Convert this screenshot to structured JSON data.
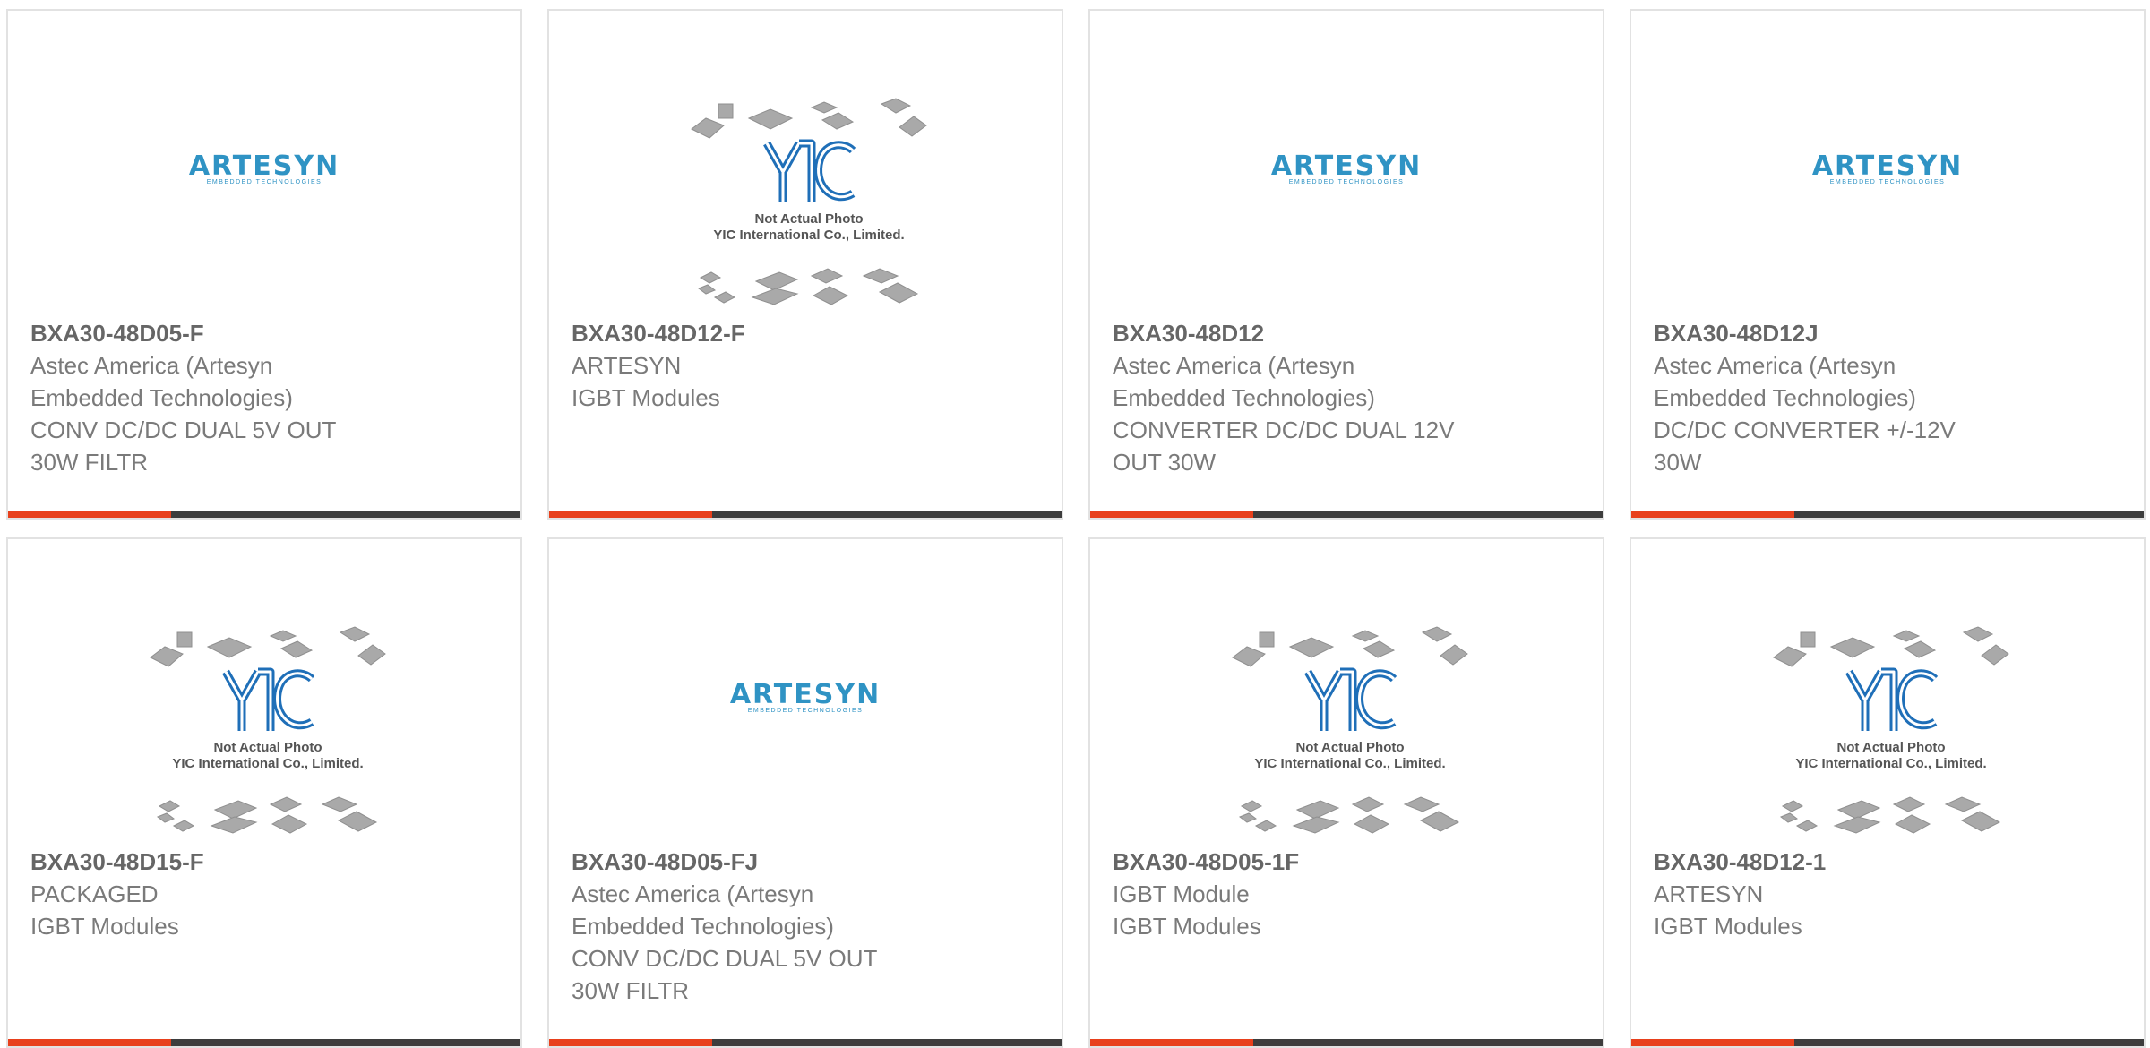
{
  "products": [
    {
      "part_number": "BXA30-48D05-F",
      "manufacturer": "Astec America (Artesyn",
      "manufacturer_cont": "Embedded Technologies)",
      "description": "CONV DC/DC DUAL 5V OUT",
      "description_cont": "30W FILTR",
      "image": "artesyn"
    },
    {
      "part_number": "BXA30-48D12-F",
      "manufacturer": "ARTESYN",
      "manufacturer_cont": "",
      "description": "IGBT Modules",
      "description_cont": "",
      "image": "yic"
    },
    {
      "part_number": "BXA30-48D12",
      "manufacturer": "Astec America (Artesyn",
      "manufacturer_cont": "Embedded Technologies)",
      "description": "CONVERTER DC/DC DUAL 12V",
      "description_cont": "OUT 30W",
      "image": "artesyn"
    },
    {
      "part_number": "BXA30-48D12J",
      "manufacturer": "Astec America (Artesyn",
      "manufacturer_cont": "Embedded Technologies)",
      "description": "DC/DC CONVERTER +/-12V",
      "description_cont": "30W",
      "image": "artesyn"
    },
    {
      "part_number": "BXA30-48D15-F",
      "manufacturer": "PACKAGED",
      "manufacturer_cont": "",
      "description": "IGBT Modules",
      "description_cont": "",
      "image": "yic"
    },
    {
      "part_number": "BXA30-48D05-FJ",
      "manufacturer": "Astec America (Artesyn",
      "manufacturer_cont": "Embedded Technologies)",
      "description": "CONV DC/DC DUAL 5V OUT",
      "description_cont": "30W FILTR",
      "image": "artesyn"
    },
    {
      "part_number": "BXA30-48D05-1F",
      "manufacturer": "IGBT Module",
      "manufacturer_cont": "",
      "description": "IGBT Modules",
      "description_cont": "",
      "image": "yic"
    },
    {
      "part_number": "BXA30-48D12-1",
      "manufacturer": "ARTESYN",
      "manufacturer_cont": "",
      "description": "IGBT Modules",
      "description_cont": "",
      "image": "yic"
    }
  ],
  "images": {
    "artesyn": {
      "logo_text": "ARTESYN",
      "logo_subtext": "EMBEDDED TECHNOLOGIES",
      "color": "#2f93c4"
    },
    "yic": {
      "logo_text": "YIC",
      "caption_line1": "Not Actual Photo",
      "caption_line2": "YIC International Co., Limited.",
      "color": "#1f6fb8"
    }
  },
  "colors": {
    "accent": "#e8401c",
    "bar": "#3d3d3d",
    "border": "#e2e2e2",
    "part_number": "#666666",
    "text": "#7a7a7a"
  }
}
